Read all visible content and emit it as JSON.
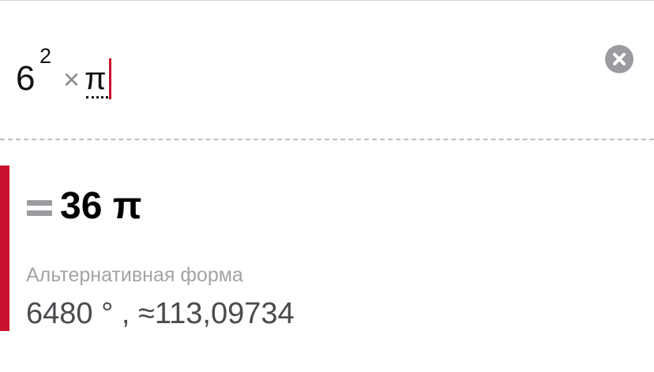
{
  "input": {
    "base": "6",
    "exponent": "2",
    "operator": "×",
    "symbol": "π",
    "clear_icon": "close-circle-icon"
  },
  "result": {
    "equals_icon": "equals-icon",
    "value": "36 π",
    "alt_label": "Альтернативная форма",
    "alt_value": "6480 ° , ≈113,09734"
  },
  "colors": {
    "accent": "#c8102e",
    "icon_gray": "#9b9ba0",
    "label_gray": "#a3a3a8",
    "text_dark": "#4a4a4f"
  }
}
